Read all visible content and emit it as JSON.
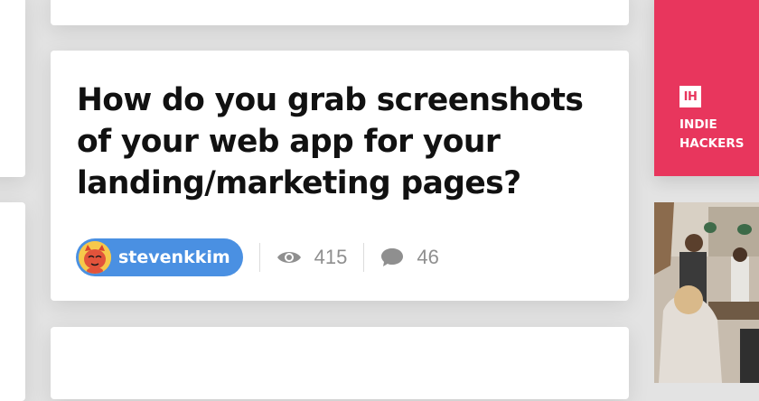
{
  "post": {
    "title": "How do you grab screenshots of your web app for your landing/marketing pages?",
    "author": "stevenkkim",
    "views": "415",
    "comments": "46"
  },
  "sidebar": {
    "brand_logo": "IH",
    "brand_name": "INDIE HACKERS"
  },
  "colors": {
    "background": "#e3e3e3",
    "author_pill": "#4a90e2",
    "brand": "#e8365d",
    "meta_text": "#8f8f8f"
  },
  "icons": {
    "views": "eye-icon",
    "comments": "comment-bubble-icon"
  }
}
